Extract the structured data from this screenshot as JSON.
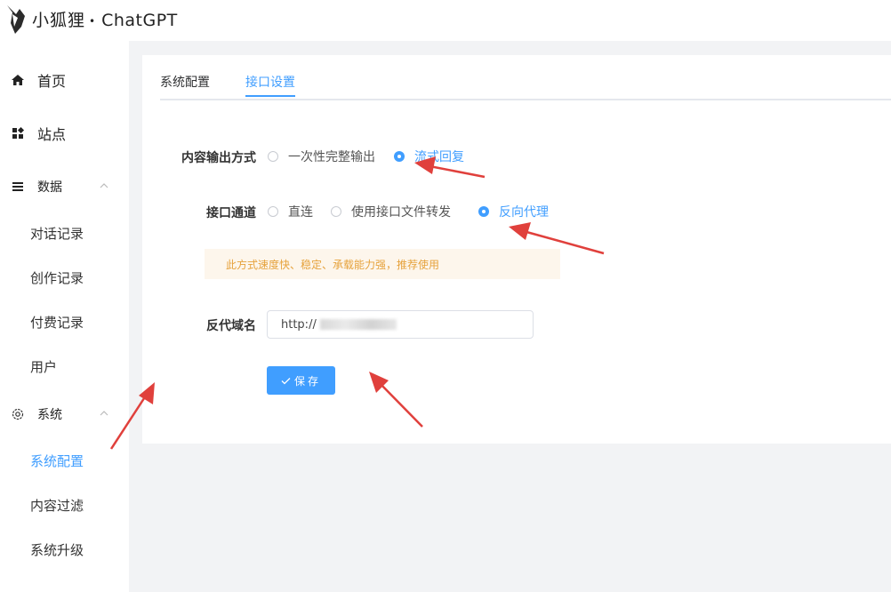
{
  "header": {
    "brand_cn": "小狐狸",
    "separator": "•",
    "brand_en": "ChatGPT",
    "logo_icon": "fox-logo-icon"
  },
  "sidebar": {
    "items": [
      {
        "label": "首页",
        "icon": "home-icon"
      },
      {
        "label": "站点",
        "icon": "grid-icon"
      }
    ],
    "groups": [
      {
        "label": "数据",
        "icon": "menu-icon",
        "expanded": true,
        "children": [
          "对话记录",
          "创作记录",
          "付费记录",
          "用户"
        ]
      },
      {
        "label": "系统",
        "icon": "gear-icon",
        "expanded": true,
        "children": [
          "系统配置",
          "内容过滤",
          "系统升级"
        ],
        "active_child": "系统配置"
      }
    ]
  },
  "tabs": [
    {
      "label": "系统配置",
      "active": false
    },
    {
      "label": "接口设置",
      "active": true
    }
  ],
  "form": {
    "output_mode": {
      "label": "内容输出方式",
      "options": [
        {
          "label": "一次性完整输出",
          "checked": false
        },
        {
          "label": "流式回复",
          "checked": true
        }
      ]
    },
    "channel": {
      "label": "接口通道",
      "options": [
        {
          "label": "直连",
          "checked": false
        },
        {
          "label": "使用接口文件转发",
          "checked": false
        },
        {
          "label": "反向代理",
          "checked": true
        }
      ]
    },
    "notice": "此方式速度快、稳定、承载能力强，推荐使用",
    "proxy_domain": {
      "label": "反代域名",
      "value": "http://"
    },
    "save_label": "保存"
  },
  "colors": {
    "primary": "#409eff",
    "notice_bg": "#fdf6ec",
    "notice_text": "#e6a23c",
    "annotation_arrow": "#e0403c"
  }
}
